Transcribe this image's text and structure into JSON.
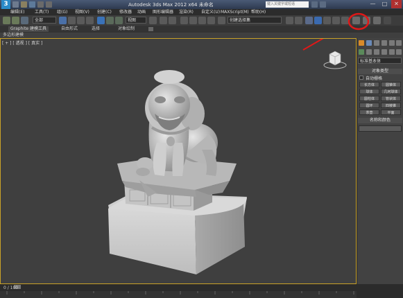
{
  "titlebar": {
    "title": "Autodesk 3ds Max 2012 x64  未命名",
    "search_placeholder": "键入关键字或短语",
    "window_controls": {
      "minimize": "—",
      "maximize": "□",
      "close": "✕"
    }
  },
  "menubar": {
    "items": [
      "编辑(E)",
      "工具(T)",
      "组(G)",
      "视图(V)",
      "创建(C)",
      "修改器",
      "动画",
      "图形编辑器",
      "渲染(R)",
      "自定义(U)",
      "MAXScript(M)",
      "帮助(H)"
    ]
  },
  "toolbar": {
    "selection_filter": "全部",
    "coord_system": "视图",
    "named_selection": "创建选择集"
  },
  "ribbon": {
    "tabs": [
      "Graphite 建模工具",
      "自由形式",
      "选择",
      "对象绘制"
    ],
    "subtitle": "多边形建模"
  },
  "viewport": {
    "label": "[ + ] [ 透视 ] [ 真实 ]"
  },
  "command_panel": {
    "dropdown": "标准基本体",
    "object_type_title": "对象类型",
    "autogrid_label": "自动栅格",
    "buttons": [
      "长方体",
      "圆锥体",
      "球体",
      "几何球体",
      "圆柱体",
      "管状体",
      "圆环",
      "四棱锥",
      "茶壶",
      "平面"
    ],
    "name_color_title": "名称和颜色"
  },
  "timeline": {
    "frame": "0 / 100"
  },
  "icons": {
    "app": "3ds-max-logo-icon",
    "render_setup": "render-setup-icon",
    "highlight": "red-circle-annotation",
    "arrow": "red-arrow-annotation",
    "viewcube": "viewcube-icon"
  },
  "colors": {
    "viewport_border": "#c9a227",
    "annotation": "#e01818",
    "background": "#3f3f3f"
  }
}
